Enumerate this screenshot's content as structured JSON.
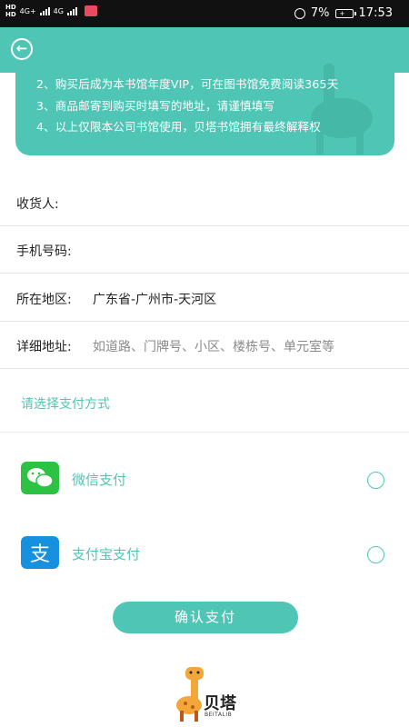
{
  "status_bar": {
    "left_hd_1": "HD",
    "left_hd_2": "HD",
    "net_1": "4G+",
    "net_2": "4G",
    "battery": "7%",
    "time": "17:53"
  },
  "header": {
    "back_icon": "arrow-left-circle-icon"
  },
  "notice": {
    "lines": [
      "2、购买后成为本书馆年度VIP，可在图书馆免费阅读365天",
      "3、商品邮寄到购买时填写的地址，请谨慎填写",
      "4、以上仅限本公司书馆使用，贝塔书馆拥有最终解释权"
    ]
  },
  "form": {
    "receiver_label": "收货人:",
    "receiver_value": "",
    "phone_label": "手机号码:",
    "phone_value": "",
    "region_label": "所在地区:",
    "region_value": "广东省-广州市-天河区",
    "address_label": "详细地址:",
    "address_placeholder": "如道路、门牌号、小区、楼栋号、单元室等"
  },
  "payment": {
    "title": "请选择支付方式",
    "options": [
      {
        "label": "微信支付",
        "icon": "wechat-pay-icon",
        "color": "#2cc243",
        "selected": false
      },
      {
        "label": "支付宝支付",
        "icon": "alipay-icon",
        "color": "#1890e0",
        "selected": false
      }
    ],
    "confirm_label": "确认支付"
  },
  "brand": {
    "name": "贝塔",
    "sub": "BEITALIB"
  },
  "colors": {
    "accent": "#4fc6b5",
    "status_bar": "#111111"
  }
}
